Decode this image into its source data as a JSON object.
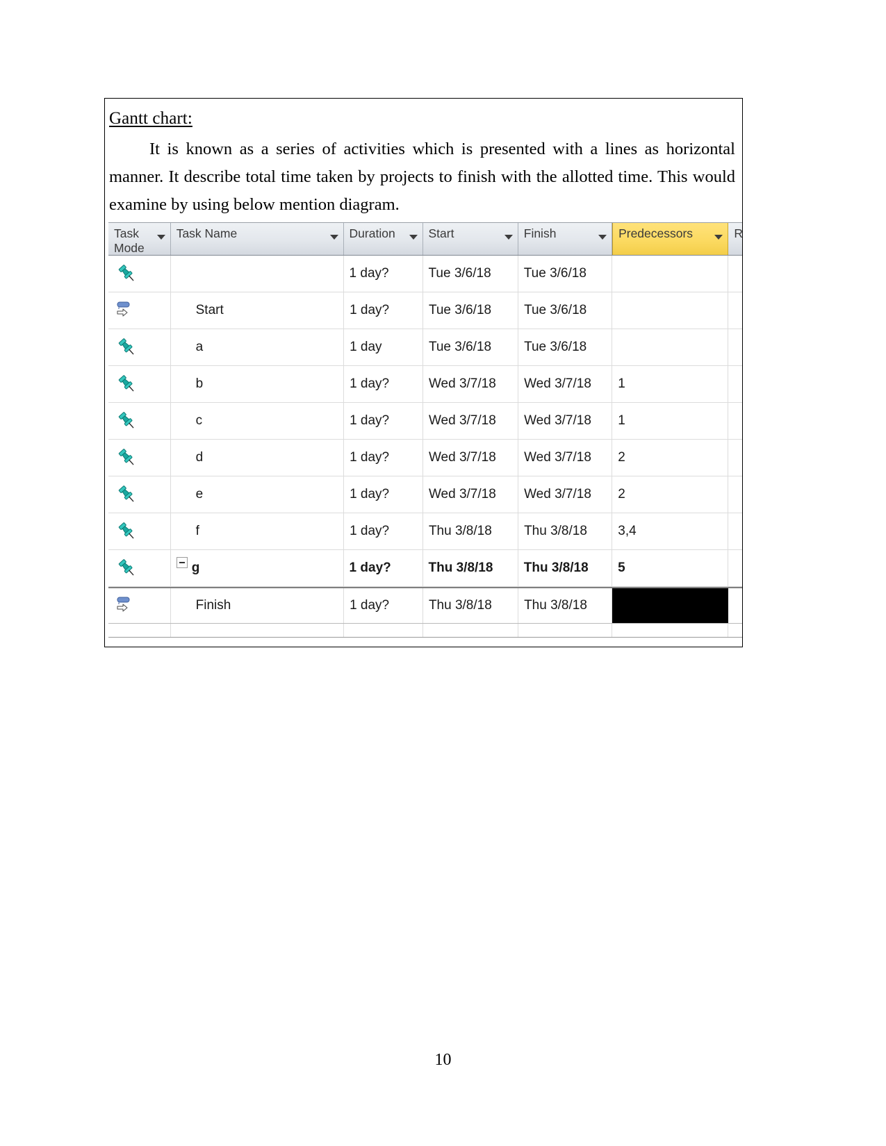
{
  "page": {
    "number": "10"
  },
  "content_box": {
    "heading": "Gantt chart:",
    "paragraph": "It is known as a series of activities which is presented with a lines as horizontal manner. It describe total time taken by projects to finish with the allotted time. This would examine by using below mention diagram."
  },
  "colors": {
    "header_gradient_top": "#eef1f4",
    "header_gradient_bottom": "#d4d9e0",
    "highlighted_column": "#fbd95f",
    "selection_black": "#000000",
    "pin_icon_teal": "#1fa9a0",
    "auto_icon_blue": "#5b7fc0",
    "grid_line": "#dcdcdc",
    "text": "#1a1a1a"
  },
  "project_grid": {
    "columns": [
      {
        "key": "task_mode",
        "label": "Task\nMode",
        "has_filter_arrow": true,
        "highlighted": false
      },
      {
        "key": "task_name",
        "label": "Task Name",
        "has_filter_arrow": true,
        "highlighted": false
      },
      {
        "key": "duration",
        "label": "Duration",
        "has_filter_arrow": true,
        "highlighted": false
      },
      {
        "key": "start",
        "label": "Start",
        "has_filter_arrow": true,
        "highlighted": false
      },
      {
        "key": "finish",
        "label": "Finish",
        "has_filter_arrow": true,
        "highlighted": false
      },
      {
        "key": "predecessors",
        "label": "Predecessors",
        "has_filter_arrow": true,
        "highlighted": true
      },
      {
        "key": "resource",
        "label": "Re",
        "has_filter_arrow": false,
        "highlighted": false
      }
    ],
    "rows": [
      {
        "task_mode_icon": "pushpin-icon",
        "task_name": "",
        "duration": "1 day?",
        "start": "Tue 3/6/18",
        "finish": "Tue 3/6/18",
        "predecessors": "",
        "resource": "",
        "bold": false,
        "indented": false,
        "collapse_toggle": false,
        "predecessor_cell_selected": false
      },
      {
        "task_mode_icon": "auto-schedule-icon",
        "task_name": "Start",
        "duration": "1 day?",
        "start": "Tue 3/6/18",
        "finish": "Tue 3/6/18",
        "predecessors": "",
        "resource": "",
        "bold": false,
        "indented": true,
        "collapse_toggle": false,
        "predecessor_cell_selected": false
      },
      {
        "task_mode_icon": "pushpin-icon",
        "task_name": "a",
        "duration": "1 day",
        "start": "Tue 3/6/18",
        "finish": "Tue 3/6/18",
        "predecessors": "",
        "resource": "",
        "bold": false,
        "indented": true,
        "collapse_toggle": false,
        "predecessor_cell_selected": false
      },
      {
        "task_mode_icon": "pushpin-icon",
        "task_name": "b",
        "duration": "1 day?",
        "start": "Wed 3/7/18",
        "finish": "Wed 3/7/18",
        "predecessors": "1",
        "resource": "",
        "bold": false,
        "indented": true,
        "collapse_toggle": false,
        "predecessor_cell_selected": false
      },
      {
        "task_mode_icon": "pushpin-icon",
        "task_name": "c",
        "duration": "1 day?",
        "start": "Wed 3/7/18",
        "finish": "Wed 3/7/18",
        "predecessors": "1",
        "resource": "",
        "bold": false,
        "indented": true,
        "collapse_toggle": false,
        "predecessor_cell_selected": false
      },
      {
        "task_mode_icon": "pushpin-icon",
        "task_name": "d",
        "duration": "1 day?",
        "start": "Wed 3/7/18",
        "finish": "Wed 3/7/18",
        "predecessors": "2",
        "resource": "",
        "bold": false,
        "indented": true,
        "collapse_toggle": false,
        "predecessor_cell_selected": false
      },
      {
        "task_mode_icon": "pushpin-icon",
        "task_name": "e",
        "duration": "1 day?",
        "start": "Wed 3/7/18",
        "finish": "Wed 3/7/18",
        "predecessors": "2",
        "resource": "",
        "bold": false,
        "indented": true,
        "collapse_toggle": false,
        "predecessor_cell_selected": false
      },
      {
        "task_mode_icon": "pushpin-icon",
        "task_name": "f",
        "duration": "1 day?",
        "start": "Thu 3/8/18",
        "finish": "Thu 3/8/18",
        "predecessors": "3,4",
        "resource": "",
        "bold": false,
        "indented": true,
        "collapse_toggle": false,
        "predecessor_cell_selected": false
      },
      {
        "task_mode_icon": "pushpin-icon",
        "task_name": "g",
        "duration": "1 day?",
        "start": "Thu 3/8/18",
        "finish": "Thu 3/8/18",
        "predecessors": "5",
        "resource": "",
        "bold": true,
        "indented": false,
        "collapse_toggle": true,
        "predecessor_cell_selected": false
      },
      {
        "task_mode_icon": "auto-schedule-icon",
        "task_name": "Finish",
        "duration": "1 day?",
        "start": "Thu 3/8/18",
        "finish": "Thu 3/8/18",
        "predecessors": "",
        "resource": "",
        "bold": false,
        "indented": true,
        "collapse_toggle": false,
        "predecessor_cell_selected": true
      }
    ]
  }
}
